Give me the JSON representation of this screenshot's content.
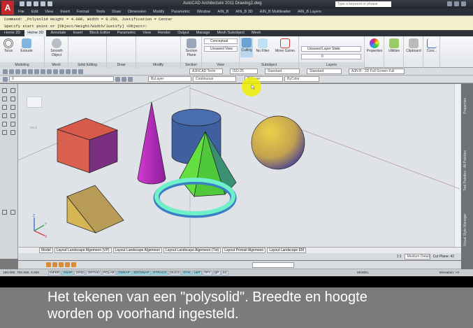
{
  "window": {
    "title": "AutoCAD Architecture 2011    Drawing2.dwg",
    "search_placeholder": "Type a keyword or phrase"
  },
  "menu": [
    "File",
    "Edit",
    "View",
    "Insert",
    "Format",
    "Tools",
    "Draw",
    "Dimension",
    "Modify",
    "Parametric",
    "Window",
    "AIN_B",
    "AIN_B 3D",
    "AIN_B Multileader",
    "AIN_B Layers"
  ],
  "command": {
    "history": "Command: _Polysolid Height = 4.000, Width = 0.250, Justification = Center",
    "prompt": "Specify start point or [Object/Height/Width/Justify] <Object>:"
  },
  "ribbon_tabs": [
    "Home 2D",
    "Home 3D",
    "Annotate",
    "Insert",
    "Block Editor",
    "Parametric",
    "View",
    "Render",
    "Output",
    "Manage",
    "Mesh Subobject",
    "Mesh"
  ],
  "ribbon": {
    "torus": "Torus",
    "extrude": "Extrude",
    "smooth": "Smooth Object",
    "section_plane": "Section Plane",
    "visual_style": "Conceptual",
    "view": "Unsaved View",
    "culling": "Culling",
    "no_filter": "No Filter",
    "move_gizmo": "Move Gizmo",
    "layer_state": "Unsaved Layer State",
    "layer": "0",
    "properties": "Properties",
    "utilities": "Utilities",
    "clipboard": "Clipboard",
    "coord": "Coor...",
    "panels": [
      "Modeling",
      "Mesh",
      "Solid Editing",
      "Draw",
      "Modify",
      "Section",
      "View",
      "Subobject",
      "Layers"
    ]
  },
  "toolbar1": {
    "text_style": "A3NCAD Techr",
    "dim_style": "ISO-25",
    "table_style": "Standard",
    "mleader_style": "Standard",
    "workspace": "A3N B - 2D Full Screen Full"
  },
  "toolbar2": {
    "layer": "0",
    "color": "ByLayer",
    "linetype": "Continuous",
    "lineweight": "ByLayer",
    "plotstyle": "ByColor"
  },
  "viewport": {
    "wcs": "WCS",
    "axis_x": "X",
    "axis_y": "Y",
    "axis_z": "Z"
  },
  "right_palettes": [
    "Properties",
    "Tool Palettes - All Palettes",
    "Visual Style Manager"
  ],
  "layout_tabs": [
    "Model",
    "Layout Landscape Algemeen (VP)",
    "Layout Landscape Algemeen",
    "Layout Landscape Algemeen (Txt)",
    "Layout Portrait Algemeen",
    "Layout Landscape EM"
  ],
  "annotation": {
    "scale": "1:1",
    "detail": "Medium Detail",
    "cut_plane": "Cut Plane: 42"
  },
  "status": {
    "coords": "190.000, 700.000, 0.000",
    "toggles": [
      {
        "l": "INFER",
        "on": false
      },
      {
        "l": "SNAP",
        "on": true
      },
      {
        "l": "GRID",
        "on": false
      },
      {
        "l": "ORTHO",
        "on": false
      },
      {
        "l": "POLAR",
        "on": false
      },
      {
        "l": "OSNAP",
        "on": true
      },
      {
        "l": "3DOSNAP",
        "on": true
      },
      {
        "l": "OTRACK",
        "on": true
      },
      {
        "l": "DUCS",
        "on": false
      },
      {
        "l": "DYN",
        "on": true
      },
      {
        "l": "LWT",
        "on": true
      },
      {
        "l": "TPY",
        "on": false
      },
      {
        "l": "QP",
        "on": false
      },
      {
        "l": "SC",
        "on": false
      }
    ],
    "model": "MODEL",
    "elevation": "Elevation: +0"
  },
  "subtitle": {
    "line1": "Het tekenen van een \"polysolid\". Breedte en hoogte",
    "line2": "worden op voorhand ingesteld."
  }
}
